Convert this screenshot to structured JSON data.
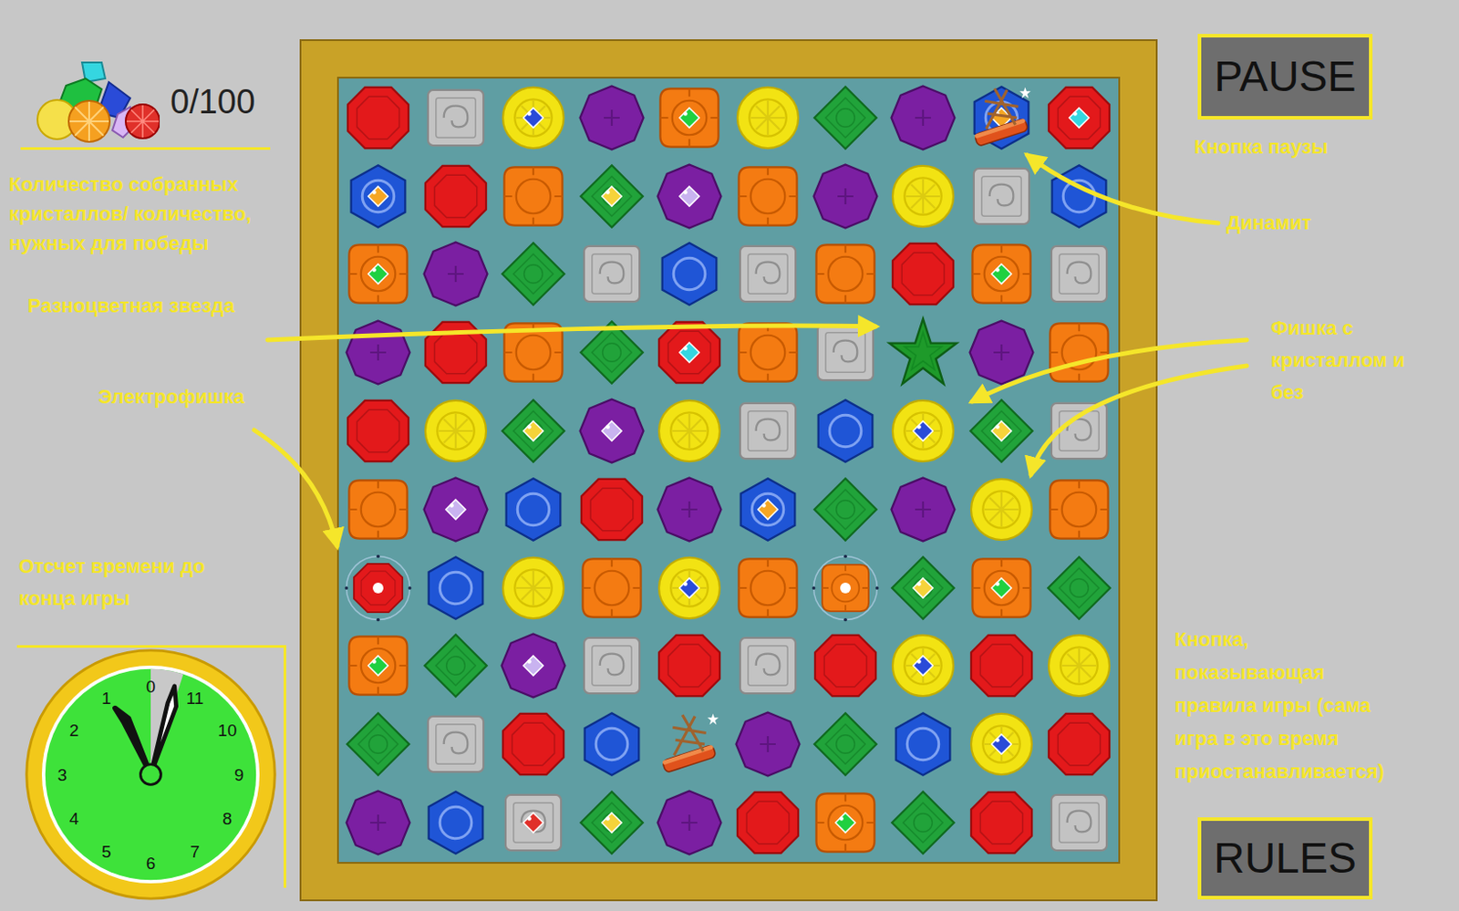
{
  "hud": {
    "counter": "0/100",
    "pause": "PAUSE",
    "rules": "RULES"
  },
  "annotations": {
    "counter": "Количество собранных кристаллов/ количество, нужных для победы",
    "star": "Разноцветная звезда",
    "electro": "Электрофишка",
    "timer": "Отсчет времени до конца игры",
    "pause": "Кнопка паузы",
    "dynamite": "Динамит",
    "crystal": "Фишка с кристаллом и без",
    "rules": "Кнопка, показывающая правила игры (сама игра в это время приостанавливается)"
  },
  "clock": {
    "numbers": [
      "0",
      "1",
      "2",
      "3",
      "4",
      "5",
      "6",
      "7",
      "8",
      "9",
      "10",
      "11"
    ],
    "level": 0.95
  },
  "board": {
    "rows": [
      [
        {
          "kind": "gem",
          "color": "#e3191b",
          "crystal": null
        },
        {
          "kind": "gem",
          "color": "#c3c3c3",
          "crystal": null
        },
        {
          "kind": "gem",
          "color": "#f2e313",
          "crystal": "#2a4bd8"
        },
        {
          "kind": "gem",
          "color": "#7b1fa2",
          "crystal": null
        },
        {
          "kind": "gem",
          "color": "#f47b12",
          "crystal": "#1fd040"
        },
        {
          "kind": "gem",
          "color": "#f2e313",
          "crystal": null
        },
        {
          "kind": "gem",
          "color": "#21a33a",
          "crystal": null
        },
        {
          "kind": "gem",
          "color": "#7b1fa2",
          "crystal": null
        },
        {
          "kind": "dynamite",
          "color": "#1f55d6",
          "crystal": "#f5a623"
        },
        {
          "kind": "gem",
          "color": "#e3191b",
          "crystal": "#35d6e0"
        }
      ],
      [
        {
          "kind": "gem",
          "color": "#1f55d6",
          "crystal": "#f5a623"
        },
        {
          "kind": "gem",
          "color": "#e3191b",
          "crystal": null
        },
        {
          "kind": "gem",
          "color": "#f47b12",
          "crystal": null
        },
        {
          "kind": "gem",
          "color": "#21a33a",
          "crystal": "#f5d33a"
        },
        {
          "kind": "gem",
          "color": "#7b1fa2",
          "crystal": "#c9b3f0"
        },
        {
          "kind": "gem",
          "color": "#f47b12",
          "crystal": null
        },
        {
          "kind": "gem",
          "color": "#7b1fa2",
          "crystal": null
        },
        {
          "kind": "gem",
          "color": "#f2e313",
          "crystal": null
        },
        {
          "kind": "gem",
          "color": "#c3c3c3",
          "crystal": null
        },
        {
          "kind": "gem",
          "color": "#1f55d6",
          "crystal": null
        }
      ],
      [
        {
          "kind": "gem",
          "color": "#f47b12",
          "crystal": "#1fd040"
        },
        {
          "kind": "gem",
          "color": "#7b1fa2",
          "crystal": null
        },
        {
          "kind": "gem",
          "color": "#21a33a",
          "crystal": null
        },
        {
          "kind": "gem",
          "color": "#c3c3c3",
          "crystal": null
        },
        {
          "kind": "gem",
          "color": "#1f55d6",
          "crystal": null
        },
        {
          "kind": "gem",
          "color": "#c3c3c3",
          "crystal": null
        },
        {
          "kind": "gem",
          "color": "#f47b12",
          "crystal": null
        },
        {
          "kind": "gem",
          "color": "#e3191b",
          "crystal": null
        },
        {
          "kind": "gem",
          "color": "#f47b12",
          "crystal": "#1fd040"
        },
        {
          "kind": "gem",
          "color": "#c3c3c3",
          "crystal": null
        }
      ],
      [
        {
          "kind": "gem",
          "color": "#7b1fa2",
          "crystal": null
        },
        {
          "kind": "gem",
          "color": "#e3191b",
          "crystal": null
        },
        {
          "kind": "gem",
          "color": "#f47b12",
          "crystal": null
        },
        {
          "kind": "gem",
          "color": "#21a33a",
          "crystal": null
        },
        {
          "kind": "gem",
          "color": "#e3191b",
          "crystal": "#35d6e0"
        },
        {
          "kind": "gem",
          "color": "#f47b12",
          "crystal": null
        },
        {
          "kind": "gem",
          "color": "#c3c3c3",
          "crystal": null
        },
        {
          "kind": "star",
          "color": "#1e9a2a",
          "crystal": null
        },
        {
          "kind": "gem",
          "color": "#7b1fa2",
          "crystal": null
        },
        {
          "kind": "gem",
          "color": "#f47b12",
          "crystal": null
        }
      ],
      [
        {
          "kind": "gem",
          "color": "#e3191b",
          "crystal": null
        },
        {
          "kind": "gem",
          "color": "#f2e313",
          "crystal": null
        },
        {
          "kind": "gem",
          "color": "#21a33a",
          "crystal": "#f5d33a"
        },
        {
          "kind": "gem",
          "color": "#7b1fa2",
          "crystal": "#c9b3f0"
        },
        {
          "kind": "gem",
          "color": "#f2e313",
          "crystal": null
        },
        {
          "kind": "gem",
          "color": "#c3c3c3",
          "crystal": null
        },
        {
          "kind": "gem",
          "color": "#1f55d6",
          "crystal": null
        },
        {
          "kind": "gem",
          "color": "#f2e313",
          "crystal": "#2a4bd8"
        },
        {
          "kind": "gem",
          "color": "#21a33a",
          "crystal": "#f5d33a"
        },
        {
          "kind": "gem",
          "color": "#c3c3c3",
          "crystal": null
        }
      ],
      [
        {
          "kind": "gem",
          "color": "#f47b12",
          "crystal": null
        },
        {
          "kind": "gem",
          "color": "#7b1fa2",
          "crystal": "#c9b3f0"
        },
        {
          "kind": "gem",
          "color": "#1f55d6",
          "crystal": null
        },
        {
          "kind": "gem",
          "color": "#e3191b",
          "crystal": null
        },
        {
          "kind": "gem",
          "color": "#7b1fa2",
          "crystal": null
        },
        {
          "kind": "gem",
          "color": "#1f55d6",
          "crystal": "#f5a623"
        },
        {
          "kind": "gem",
          "color": "#21a33a",
          "crystal": null
        },
        {
          "kind": "gem",
          "color": "#7b1fa2",
          "crystal": null
        },
        {
          "kind": "gem",
          "color": "#f2e313",
          "crystal": null
        },
        {
          "kind": "gem",
          "color": "#f47b12",
          "crystal": null
        }
      ],
      [
        {
          "kind": "electro",
          "color": "#e3191b",
          "crystal": "#ffffff"
        },
        {
          "kind": "gem",
          "color": "#1f55d6",
          "crystal": null
        },
        {
          "kind": "gem",
          "color": "#f2e313",
          "crystal": null
        },
        {
          "kind": "gem",
          "color": "#f47b12",
          "crystal": null
        },
        {
          "kind": "gem",
          "color": "#f2e313",
          "crystal": "#2a4bd8"
        },
        {
          "kind": "gem",
          "color": "#f47b12",
          "crystal": null
        },
        {
          "kind": "electro",
          "color": "#f47b12",
          "crystal": "#ffffff"
        },
        {
          "kind": "gem",
          "color": "#21a33a",
          "crystal": "#f5d33a"
        },
        {
          "kind": "gem",
          "color": "#f47b12",
          "crystal": "#1fd040"
        },
        {
          "kind": "gem",
          "color": "#21a33a",
          "crystal": null
        }
      ],
      [
        {
          "kind": "gem",
          "color": "#f47b12",
          "crystal": "#1fd040"
        },
        {
          "kind": "gem",
          "color": "#21a33a",
          "crystal": null
        },
        {
          "kind": "gem",
          "color": "#7b1fa2",
          "crystal": "#c9b3f0"
        },
        {
          "kind": "gem",
          "color": "#c3c3c3",
          "crystal": null
        },
        {
          "kind": "gem",
          "color": "#e3191b",
          "crystal": null
        },
        {
          "kind": "gem",
          "color": "#c3c3c3",
          "crystal": null
        },
        {
          "kind": "gem",
          "color": "#e3191b",
          "crystal": null
        },
        {
          "kind": "gem",
          "color": "#f2e313",
          "crystal": "#2a4bd8"
        },
        {
          "kind": "gem",
          "color": "#e3191b",
          "crystal": null
        },
        {
          "kind": "gem",
          "color": "#f2e313",
          "crystal": null
        }
      ],
      [
        {
          "kind": "gem",
          "color": "#21a33a",
          "crystal": null
        },
        {
          "kind": "gem",
          "color": "#c3c3c3",
          "crystal": null
        },
        {
          "kind": "gem",
          "color": "#e3191b",
          "crystal": null
        },
        {
          "kind": "gem",
          "color": "#1f55d6",
          "crystal": null
        },
        {
          "kind": "dynamite",
          "color": null,
          "crystal": null
        },
        {
          "kind": "gem",
          "color": "#7b1fa2",
          "crystal": null
        },
        {
          "kind": "gem",
          "color": "#21a33a",
          "crystal": null
        },
        {
          "kind": "gem",
          "color": "#1f55d6",
          "crystal": null
        },
        {
          "kind": "gem",
          "color": "#f2e313",
          "crystal": "#2a4bd8"
        },
        {
          "kind": "gem",
          "color": "#e3191b",
          "crystal": null
        }
      ],
      [
        {
          "kind": "gem",
          "color": "#7b1fa2",
          "crystal": null
        },
        {
          "kind": "gem",
          "color": "#1f55d6",
          "crystal": null
        },
        {
          "kind": "gem",
          "color": "#c3c3c3",
          "crystal": "#e0302a"
        },
        {
          "kind": "gem",
          "color": "#21a33a",
          "crystal": "#f5d33a"
        },
        {
          "kind": "gem",
          "color": "#7b1fa2",
          "crystal": null
        },
        {
          "kind": "gem",
          "color": "#e3191b",
          "crystal": null
        },
        {
          "kind": "gem",
          "color": "#f47b12",
          "crystal": "#1fd040"
        },
        {
          "kind": "gem",
          "color": "#21a33a",
          "crystal": null
        },
        {
          "kind": "gem",
          "color": "#e3191b",
          "crystal": null
        },
        {
          "kind": "gem",
          "color": "#c3c3c3",
          "crystal": null
        }
      ]
    ]
  }
}
